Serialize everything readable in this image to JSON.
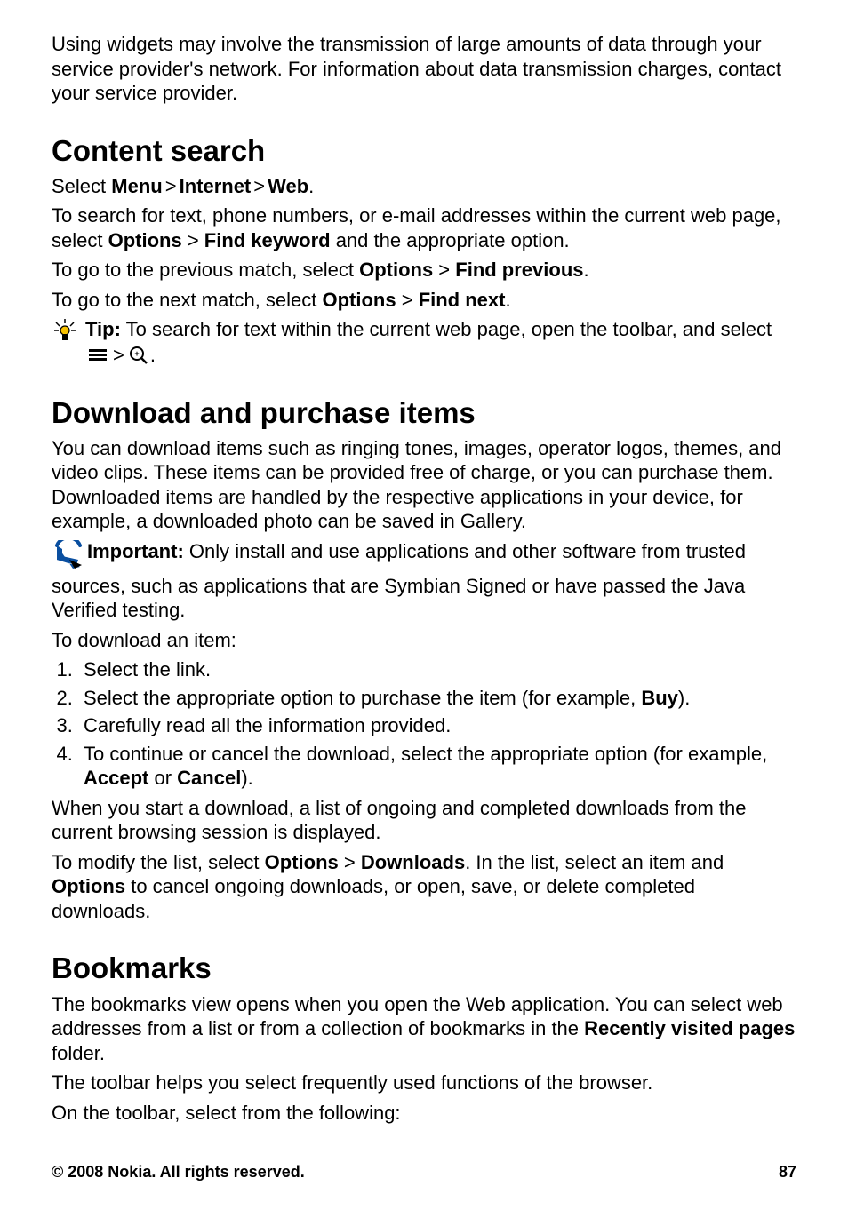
{
  "intro_p": "Using widgets may involve the transmission of large amounts of data through your service provider's network. For information about data transmission charges, contact your service provider.",
  "s1": {
    "title": "Content search",
    "nav": {
      "select": "Select ",
      "menu": "Menu",
      "gt": ">",
      "internet": "Internet",
      "web": "Web",
      "period": "."
    },
    "p2a": "To search for text, phone numbers, or e-mail addresses within the current web page, select ",
    "options": "Options",
    "p2b": " > ",
    "findkw": "Find keyword",
    "p2c": " and the appropriate option.",
    "p3a": "To go to the previous match, select ",
    "findprev": "Find previous",
    "p3c": ".",
    "p4a": "To go to the next match, select ",
    "findnext": "Find next",
    "p4c": ".",
    "tiplabel": "Tip:",
    "tiptext": " To search for text within the current web page, open the toolbar, and select",
    "tip_end": "."
  },
  "s2": {
    "title": "Download and purchase items",
    "p1": "You can download items such as ringing tones, images, operator logos, themes, and video clips. These items can be provided free of charge, or you can purchase them. Downloaded items are handled by the respective applications in your device, for example, a downloaded photo can be saved in Gallery.",
    "implabel": "Important:",
    "imptext": "  Only install and use applications and other software from trusted sources, such as applications that are Symbian Signed or have passed the Java Verified testing.",
    "p2": "To download an item:",
    "li1": "Select the link.",
    "li2a": "Select the appropriate option to purchase the item (for example, ",
    "li2b": "Buy",
    "li2c": ").",
    "li3": "Carefully read all the information provided.",
    "li4a": "To continue or cancel the download, select the appropriate option (for example, ",
    "li4b": "Accept",
    "li4c": " or ",
    "li4d": "Cancel",
    "li4e": ").",
    "p3": "When you start a download, a list of ongoing and completed downloads from the current browsing session is displayed.",
    "p4a": "To modify the list, select ",
    "options": "Options",
    "p4b": " > ",
    "downloads": "Downloads",
    "p4c": ". In the list, select an item and ",
    "options2": "Options",
    "p4d": " to cancel ongoing downloads, or open, save, or delete completed downloads."
  },
  "s3": {
    "title": "Bookmarks",
    "p1a": "The bookmarks view opens when you open the Web application. You can select web addresses from a list or from a collection of bookmarks in the ",
    "rvp": "Recently visited pages",
    "p1b": " folder.",
    "p2": "The toolbar helps you select frequently used functions of the browser.",
    "p3": "On the toolbar, select from the following:"
  },
  "footer": {
    "left": "© 2008 Nokia. All rights reserved.",
    "right": "87"
  }
}
